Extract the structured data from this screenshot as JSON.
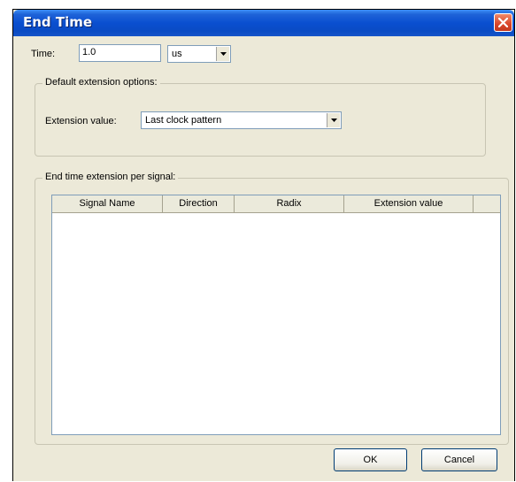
{
  "window": {
    "title": "End Time"
  },
  "time": {
    "label": "Time:",
    "value": "1.0",
    "unit": "us"
  },
  "default_options": {
    "group_title": "Default extension options:",
    "extension_label": "Extension value:",
    "extension_value": "Last clock pattern"
  },
  "per_signal": {
    "group_title": "End time extension per signal:",
    "columns": [
      "Signal Name",
      "Direction",
      "Radix",
      "Extension value"
    ],
    "rows": []
  },
  "buttons": {
    "ok": "OK",
    "cancel": "Cancel"
  },
  "colors": {
    "title_bar": "#0a4fd0",
    "dialog_bg": "#ece9d8",
    "close_button": "#d9452a"
  }
}
